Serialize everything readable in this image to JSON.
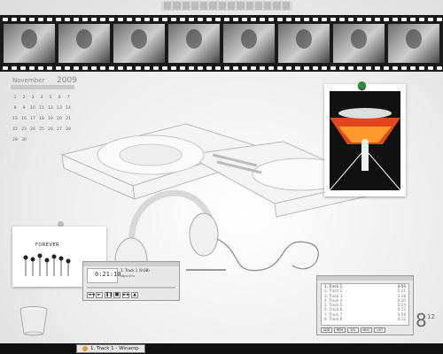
{
  "calendar": {
    "month": "November",
    "year": "2009",
    "days": [
      "1",
      "2",
      "3",
      "4",
      "5",
      "6",
      "7",
      "8",
      "9",
      "10",
      "11",
      "12",
      "13",
      "14",
      "15",
      "16",
      "17",
      "18",
      "19",
      "20",
      "21",
      "22",
      "23",
      "24",
      "25",
      "26",
      "27",
      "28",
      "29",
      "30"
    ]
  },
  "note": {
    "title": "FOREVER"
  },
  "winamp": {
    "time": "0:21:10",
    "song": "1. Track 1 (9:08)",
    "info": "kbps  kHz",
    "buttons": [
      "◄◄",
      "►",
      "❚❚",
      "■",
      "►►",
      "▲"
    ]
  },
  "playlist": {
    "tracks": [
      {
        "name": "1. Track 1",
        "len": "4:59"
      },
      {
        "name": "2. Track 2",
        "len": "5:21"
      },
      {
        "name": "3. Track 3",
        "len": "4:18"
      },
      {
        "name": "4. Track 4",
        "len": "4:20"
      },
      {
        "name": "5. Track 5",
        "len": "5:14"
      },
      {
        "name": "6. Track 6",
        "len": "4:12"
      },
      {
        "name": "7. Track 7",
        "len": "4:59"
      },
      {
        "name": "8. Track 8",
        "len": "4:12"
      }
    ],
    "buttons": [
      "ADD",
      "REM",
      "SEL",
      "MISC",
      "LIST"
    ]
  },
  "clock": {
    "hour": "8",
    "minute": "12"
  },
  "taskbar": {
    "task": "1. Track 1 - Winamp"
  },
  "colors": {
    "accent": "#2e8b3a",
    "taskbar": "#111111"
  },
  "icons": [
    "recycle-bin-icon",
    "winamp-icon",
    "pushpin-icon"
  ]
}
